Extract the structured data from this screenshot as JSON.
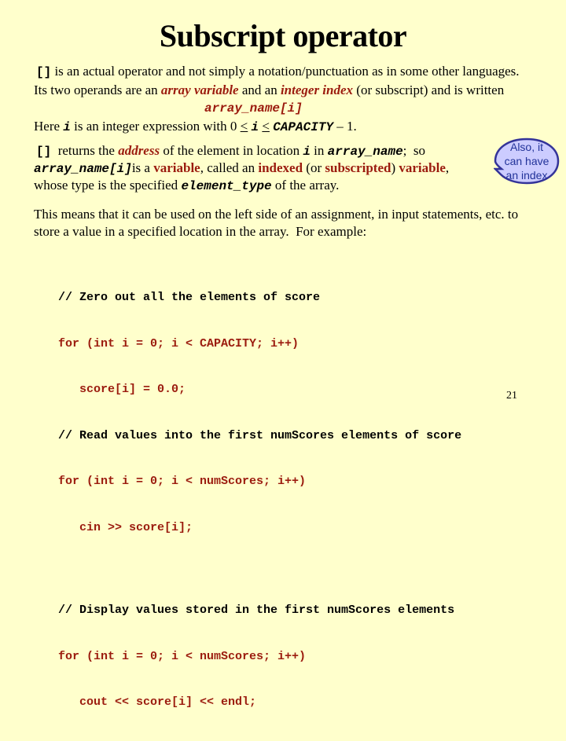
{
  "slide": {
    "title": "Subscript operator",
    "para1": {
      "op": "[]",
      "text": " is an actual operator and not simply a notation/punctuation as in some other languages."
    },
    "para2": {
      "pre": "Its two operands are an ",
      "term1": "array variable",
      "mid": " and an ",
      "term2": "integer index",
      "post": " (or subscript) and is written"
    },
    "syntax": "array_name[i]",
    "para3": {
      "pre": "Here ",
      "var": "i",
      "mid": " is an integer expression with 0 ",
      "le1": "<",
      "var2": "i",
      "le2": "<",
      "cap": "CAPACITY",
      "post": " – 1."
    },
    "para4": {
      "line1": {
        "op": "[]",
        "a": "  returns the ",
        "address": "address",
        "b": " of the element in location ",
        "var": "i",
        "c": " in ",
        "arr": "array_name",
        "d": ";  so"
      },
      "line2": {
        "expr": "array_name[i]",
        "a": "is a ",
        "variable": "variable",
        "b": ", called an ",
        "indexed": "indexed",
        "c": " (or ",
        "subscripted": "subscripted",
        "d": ") ",
        "variable2": "variable",
        "e": ","
      },
      "line3": {
        "a": "whose type is the specified ",
        "type": "element_type",
        "b": " of the array."
      }
    },
    "callout": {
      "lines": [
        "Also, it",
        "can have",
        "an index"
      ]
    },
    "para5": {
      "line1": "This means that it can be used on the left side of an assignment, in input statements, etc. to",
      "line2": "store a value in a specified location in the array.  For example:"
    },
    "code": [
      {
        "type": "comment",
        "text": "// Zero out all the elements of score"
      },
      {
        "type": "code",
        "text": "for (int i = 0; i < CAPACITY; i++)"
      },
      {
        "type": "code",
        "text": "   score[i] = 0.0;"
      },
      {
        "type": "comment",
        "text": "// Read values into the first numScores elements of score"
      },
      {
        "type": "code",
        "text": "for (int i = 0; i < numScores; i++)"
      },
      {
        "type": "code",
        "text": "   cin >> score[i];"
      },
      {
        "type": "gap",
        "text": ""
      },
      {
        "type": "comment",
        "text": "// Display values stored in the first numScores elements"
      },
      {
        "type": "code",
        "text": "for (int i = 0; i < numScores; i++)"
      },
      {
        "type": "code",
        "text": "   cout << score[i] << endl;"
      }
    ],
    "page_number": "21"
  },
  "colors": {
    "background": "#ffffcc",
    "accent_red": "#9b1b0e",
    "callout_fill": "#ccccff",
    "callout_border": "#333399"
  }
}
